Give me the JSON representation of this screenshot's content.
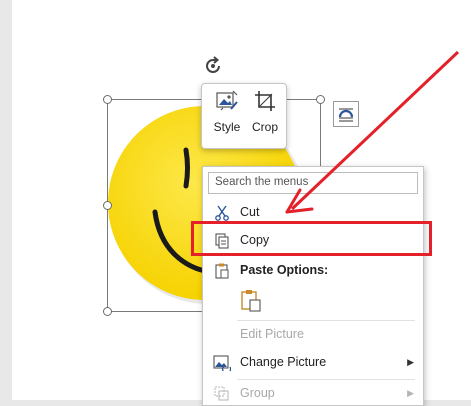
{
  "colors": {
    "smiley_yellow": "#fde32b",
    "annotation_red": "#e4202a",
    "disabled_text": "#a8a8a8"
  },
  "mini_toolbar": {
    "style_label": "Style",
    "crop_label": "Crop"
  },
  "context_menu": {
    "search_placeholder": "Search the menus",
    "cut_label": "Cut",
    "copy_label": "Copy",
    "paste_options_label": "Paste Options:",
    "edit_picture_label": "Edit Picture",
    "change_picture_label": "Change Picture",
    "group_label": "Group"
  },
  "icons": {
    "rotate": "rotate-icon",
    "layout_options": "layout-options-icon",
    "style": "picture-style-icon",
    "crop": "crop-icon",
    "cut": "scissors-icon",
    "copy": "copy-icon",
    "paste": "clipboard-icon",
    "keep_format": "paste-picture-icon",
    "change_picture": "change-picture-icon",
    "group": "group-icon",
    "submenu": "chevron-right-icon"
  }
}
